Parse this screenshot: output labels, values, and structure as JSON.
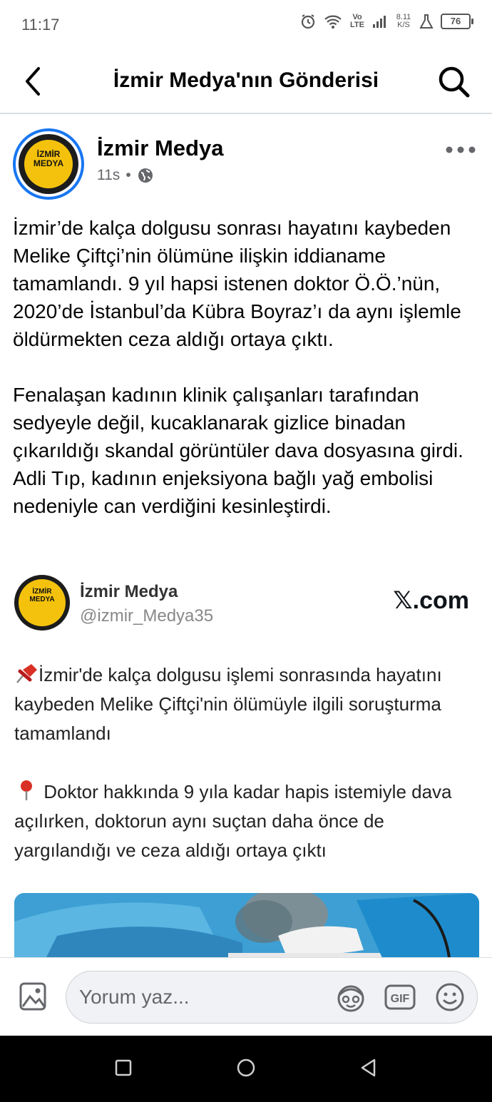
{
  "status_bar": {
    "time": "11:17",
    "network": "Vo LTE",
    "net_speed": "8.11 K/S",
    "battery": "76"
  },
  "header": {
    "title": "İzmir Medya'nın Gönderisi"
  },
  "post": {
    "author": "İzmir Medya",
    "time": "11s",
    "separator": "•",
    "paragraphs": [
      "İzmir’de kalça dolgusu sonrası hayatını kaybeden Melike Çiftçi’nin ölümüne ilişkin iddianame tamamlandı. 9 yıl hapsi istenen doktor Ö.Ö.’nün, 2020’de İstanbul’da Kübra Boyraz’ı da aynı işlemle öldürmekten ceza aldığı ortaya çıktı.",
      "Fenalaşan kadının klinik çalışanları tarafından sedyeyle değil, kucaklanarak gizlice binadan çıkarıldığı skandal görüntüler dava dosyasına girdi. Adli Tıp, kadının enjeksiyona bağlı yağ embolisi nedeniyle can verdiğini kesinleştirdi."
    ],
    "logo_text_line1": "İZMİR",
    "logo_text_line2": "MEDYA"
  },
  "tweet": {
    "name": "İzmir Medya",
    "handle": "@izmir_Medya35",
    "source": "𝕏.com",
    "paragraphs": [
      "İzmir'de  kalça dolgusu işlemi sonrasında hayatını kaybeden Melike Çiftçi'nin ölümüyle ilgili soruşturma tamamlandı",
      " Doktor hakkında 9 yıla kadar hapis istemiyle dava açılırken, doktorun aynı suçtan daha önce de yargılandığı ve ceza aldığı ortaya çıktı"
    ],
    "icons": [
      "pushpin-icon",
      "round-pushpin-icon"
    ]
  },
  "comment_bar": {
    "placeholder": "Yorum yaz...",
    "gif_label": "GIF"
  },
  "colors": {
    "accent": "#1877f2",
    "text": "#050505",
    "secondary_text": "#65676b",
    "logo_yellow": "#f4c20d",
    "nav_bar": "#000000"
  }
}
